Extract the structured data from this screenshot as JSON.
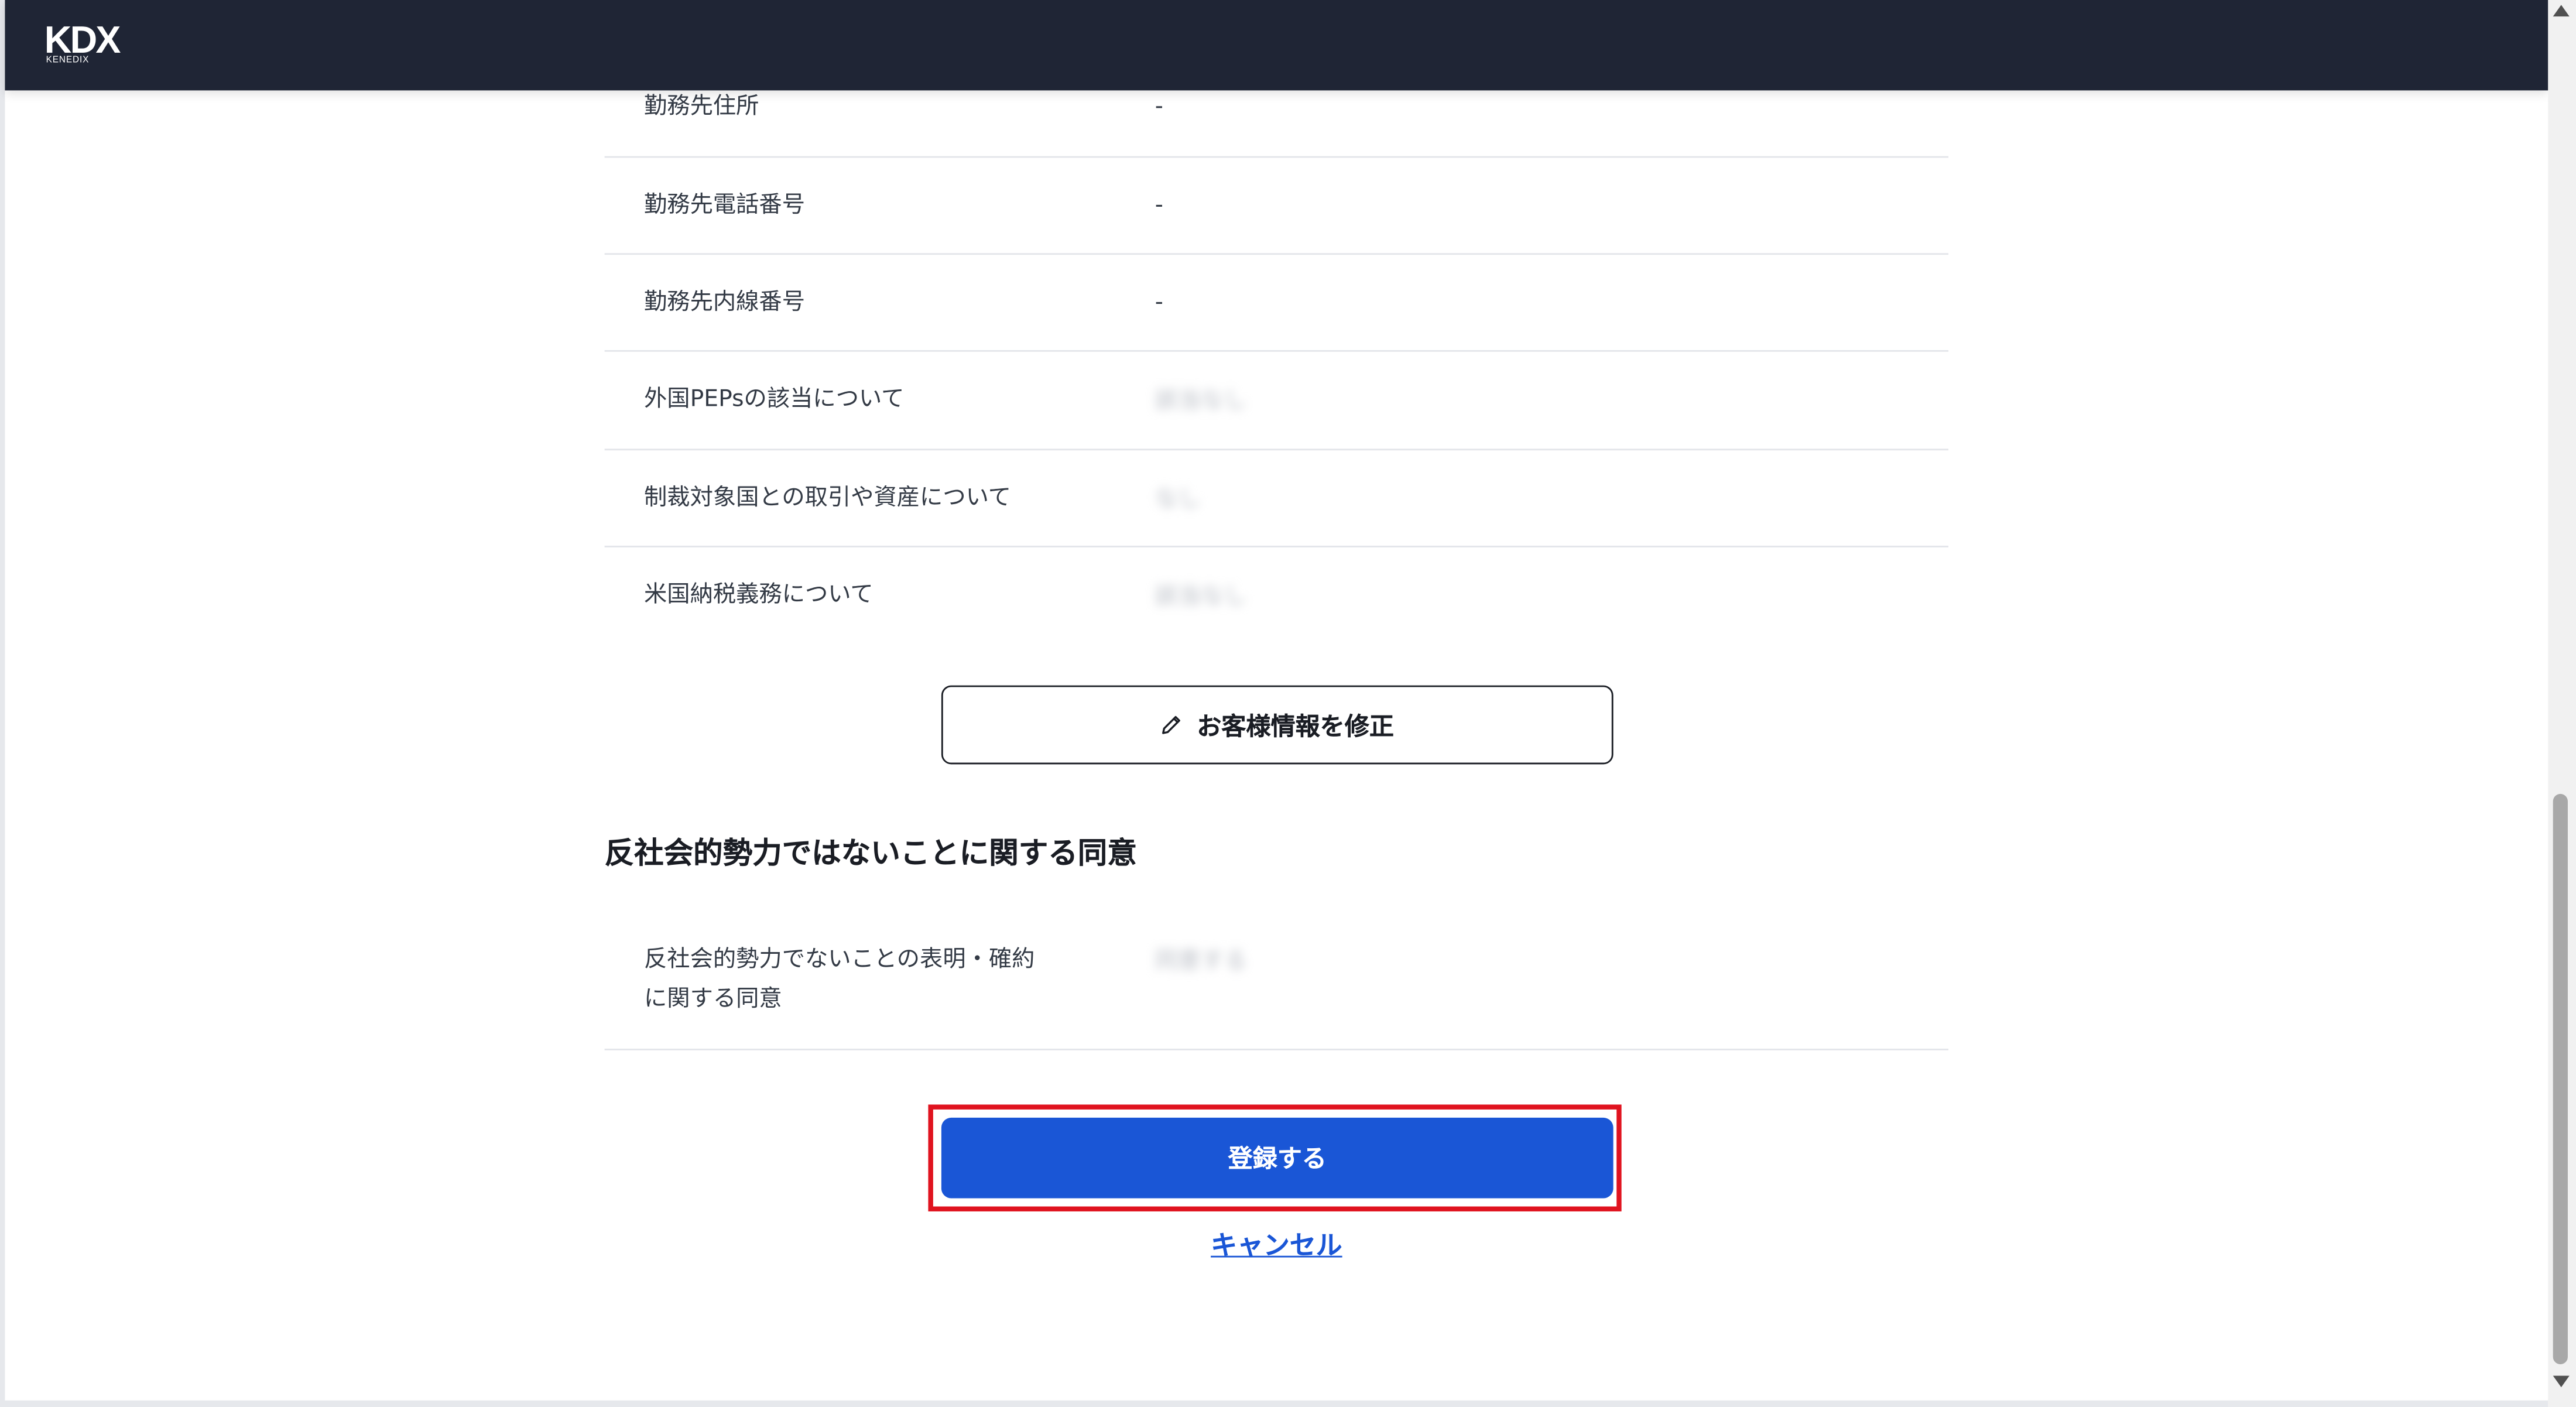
{
  "header": {
    "logo_text": "KDX",
    "logo_subtext": "KENEDIX"
  },
  "info_rows": [
    {
      "label": "勤務先住所",
      "value": "-"
    },
    {
      "label": "勤務先電話番号",
      "value": "-"
    },
    {
      "label": "勤務先内線番号",
      "value": "-"
    },
    {
      "label": "外国PEPsの該当について",
      "value": "該当なし"
    },
    {
      "label": "制裁対象国との取引や資産について",
      "value": "なし"
    },
    {
      "label": "米国納税義務について",
      "value": "該当なし"
    }
  ],
  "edit_button": {
    "icon": "pencil-icon",
    "label": "お客様情報を修正"
  },
  "consent_section": {
    "title": "反社会的勢力ではないことに関する同意",
    "label": "反社会的勢力でないことの表明・確約に関する同意",
    "value": "同意する"
  },
  "actions": {
    "register_label": "登録する",
    "cancel_label": "キャンセル"
  },
  "colors": {
    "header_bg": "#1f2535",
    "primary": "#1a56d6",
    "highlight": "#e0131f"
  }
}
